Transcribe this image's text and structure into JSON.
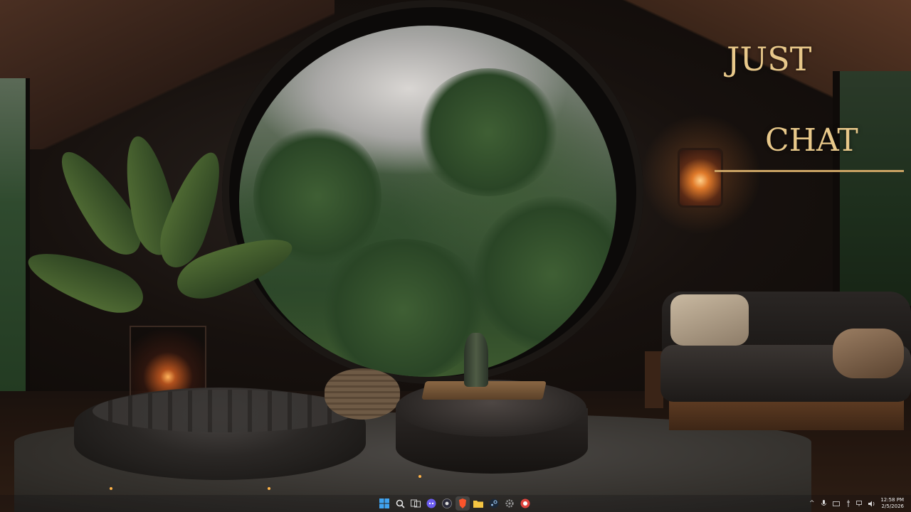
{
  "wallpaper": {
    "overlay_line1": "JUST",
    "overlay_line2": "CHAT",
    "accent": "#e8c88a"
  },
  "taskbar": {
    "start_icon": "windows-start-icon",
    "pinned": [
      {
        "name": "search",
        "icon": "search-icon",
        "color": "#e6e6e6"
      },
      {
        "name": "task-view",
        "icon": "task-view-icon",
        "color": "#cfcfcf"
      },
      {
        "name": "chat-app",
        "icon": "discord-like-icon",
        "color": "#6b5cf0"
      },
      {
        "name": "obs",
        "icon": "record-icon",
        "color": "#2a2a3a"
      },
      {
        "name": "brave",
        "icon": "brave-browser-icon",
        "color": "#fb542b"
      },
      {
        "name": "file-explorer",
        "icon": "folder-icon",
        "color": "#f5c542"
      },
      {
        "name": "steam",
        "icon": "steam-icon",
        "color": "#3b6ea5"
      },
      {
        "name": "settings",
        "icon": "gear-icon",
        "color": "#9a9a9a"
      },
      {
        "name": "app",
        "icon": "red-app-icon",
        "color": "#e0443e"
      }
    ],
    "tray": {
      "time": "12:58 PM",
      "date": "2/5/2026"
    }
  }
}
